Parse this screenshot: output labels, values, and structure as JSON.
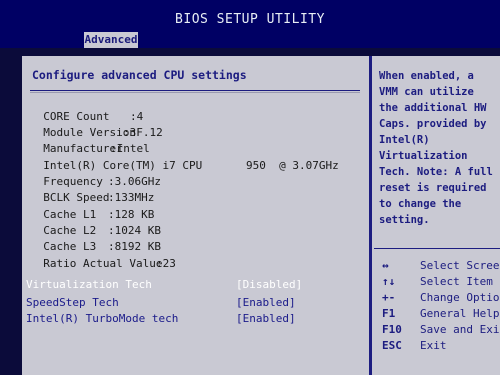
{
  "header": {
    "title": "BIOS SETUP UTILITY",
    "active_tab": "Advanced"
  },
  "main": {
    "heading": "Configure advanced CPU settings",
    "info": [
      {
        "label": "CORE Count",
        "value": ":4"
      },
      {
        "label": "Module Version",
        "value": ":3F.12"
      },
      {
        "label": "Manufacturer",
        "value": ":Intel"
      },
      {
        "label": "Intel(R) Core(TM) i7 CPU",
        "value": "950  @ 3.07GHz"
      },
      {
        "label": "Frequency",
        "value": ":3.06GHz"
      },
      {
        "label": "BCLK Speed",
        "value": ":133MHz"
      },
      {
        "label": "Cache L1",
        "value": ":128 KB"
      },
      {
        "label": "Cache L2",
        "value": ":1024 KB"
      },
      {
        "label": "Cache L3",
        "value": ":8192 KB"
      },
      {
        "label": "Ratio Actual Value",
        "value": ":23"
      }
    ],
    "options": [
      {
        "label": "Virtualization Tech",
        "value": "[Disabled]",
        "selected": true
      },
      {
        "label": "SpeedStep Tech",
        "value": "[Enabled]",
        "selected": false
      },
      {
        "label": "Intel(R) TurboMode tech",
        "value": "[Enabled]",
        "selected": false
      }
    ]
  },
  "help": {
    "text": "When enabled, a VMM can utilize the additional HW Caps. provided by Intel(R) Virtualization Tech. Note: A full reset is required to change the setting."
  },
  "keys": [
    {
      "key": "↔",
      "desc": "Select Screen"
    },
    {
      "key": "↑↓",
      "desc": "Select Item"
    },
    {
      "key": "+-",
      "desc": "Change Option"
    },
    {
      "key": "F1",
      "desc": "General Help"
    },
    {
      "key": "F10",
      "desc": "Save and Exit"
    },
    {
      "key": "ESC",
      "desc": "Exit"
    }
  ]
}
